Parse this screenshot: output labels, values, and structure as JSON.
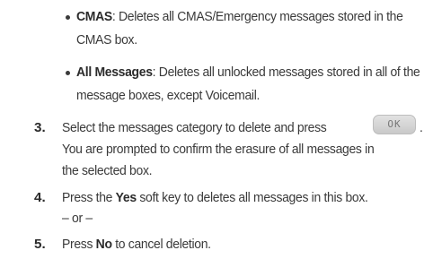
{
  "bullets": [
    {
      "term": "CMAS",
      "line1": ": Deletes all CMAS/Emergency messages stored in the",
      "line2": "CMAS box."
    },
    {
      "term": "All Messages",
      "line1": ": Deletes all unlocked messages stored in all of the",
      "line2": "message boxes, except Voicemail."
    }
  ],
  "steps": [
    {
      "number": "3.",
      "line1": "Select the messages category to delete and press",
      "key_label": "OK",
      "line1_end": ".",
      "line2": "You are prompted to confirm the erasure of all messages in",
      "line3": "the selected box."
    },
    {
      "number": "4.",
      "pre": "Press the ",
      "bold": "Yes",
      "post": " soft key to deletes all messages in this box.",
      "line2": "– or –"
    },
    {
      "number": "5.",
      "pre": "Press ",
      "bold": "No",
      "post": " to cancel deletion."
    }
  ]
}
